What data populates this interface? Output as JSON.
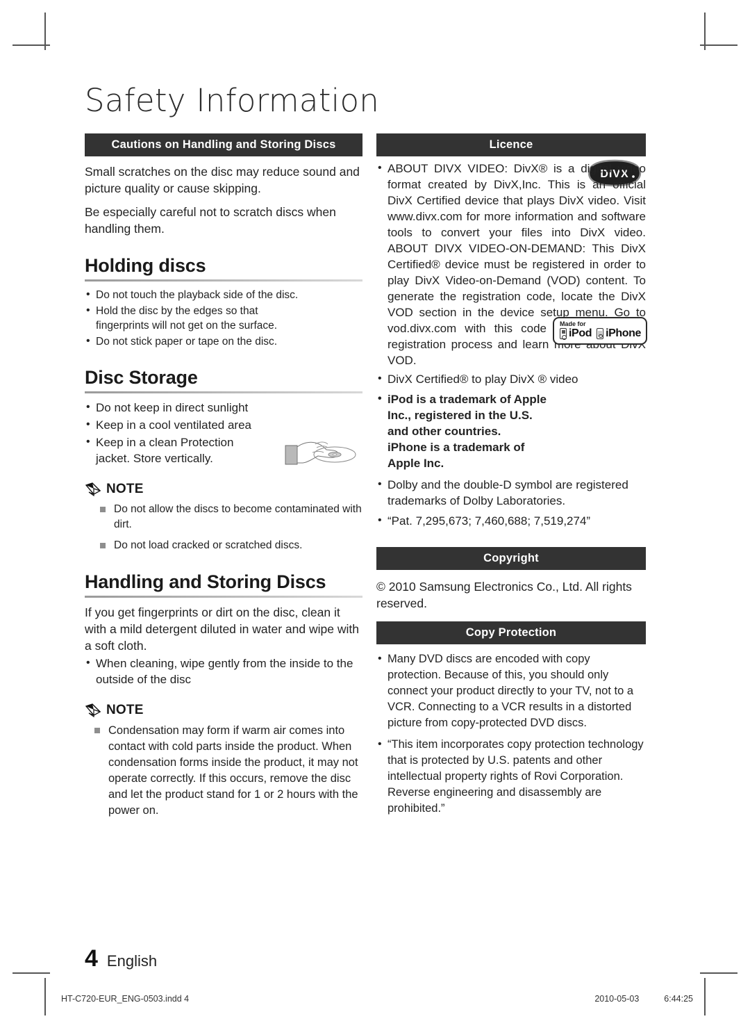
{
  "page": {
    "title": "Safety Information",
    "number": "4",
    "language": "English"
  },
  "left_column": {
    "section_bar": "Cautions on Handling and Storing Discs",
    "intro_paragraphs": [
      "Small scratches on the disc may reduce sound and picture quality or cause skipping.",
      "Be especially careful not to scratch discs when handling them."
    ],
    "holding_discs": {
      "heading": "Holding discs",
      "bullets": [
        "Do not touch the playback side of the disc.",
        "Hold the disc by the edges so that fingerprints will not get on the surface.",
        "Do not stick paper or tape on the disc."
      ]
    },
    "disc_storage": {
      "heading": "Disc Storage",
      "bullets": [
        "Do not keep in direct sunlight",
        "Keep in a cool ventilated area",
        "Keep in a clean Protection jacket. Store vertically."
      ]
    },
    "note_one": {
      "label": "NOTE",
      "items": [
        "Do not allow the discs to become contaminated with dirt.",
        "Do not load cracked or scratched discs."
      ]
    },
    "handling_storing": {
      "heading": "Handling and Storing Discs",
      "paragraph": "If you get fingerprints or dirt on the disc, clean it with a mild detergent diluted in water and wipe with a soft cloth.",
      "bullets": [
        "When cleaning, wipe gently from the inside to the outside of the disc"
      ]
    },
    "note_two": {
      "label": "NOTE",
      "items": [
        "Condensation may form if warm air comes into contact with cold parts inside the product. When condensation forms inside the product, it may not operate correctly. If this occurs, remove the disc and let the product stand for 1 or 2 hours with the power on."
      ]
    }
  },
  "right_column": {
    "licence": {
      "section_bar": "Licence",
      "divx_paragraph": "ABOUT DIVX VIDEO: DivX® is a digital video format created by DivX,Inc. This is an official DivX Certified device that plays DivX video. Visit www.divx.com for more information and software tools to convert your files into DivX video. ABOUT DIVX VIDEO-ON-DEMAND: This DivX Certified® device must be registered in order to play DivX Video-on-Demand (VOD) content. To generate the registration code, locate the DivX VOD section in the device setup menu. Go to vod.divx.com with this  code to complete the registration process and learn more about DivX VOD.",
      "divx_certified": "DivX Certified® to play DivX ® video",
      "apple_trademark_bold": "iPod is a trademark of Apple Inc., registered in the U.S. and other countries.",
      "apple_trademark_bold_2": "iPhone is a trademark of Apple Inc.",
      "dolby": "Dolby and the double-D symbol are registered trademarks of Dolby Laboratories.",
      "patents": "“Pat. 7,295,673; 7,460,688; 7,519,274”",
      "divx_logo_text": "DIVX",
      "ipod_badge": {
        "made_for": "Made for",
        "ipod": "iPod",
        "iphone": "iPhone"
      }
    },
    "copyright": {
      "section_bar": "Copyright",
      "text": "© 2010 Samsung Electronics Co., Ltd. All rights reserved."
    },
    "copy_protection": {
      "section_bar": "Copy Protection",
      "bullets": [
        "Many DVD discs are encoded with copy protection. Because of this, you should only connect your product directly to your TV, not to a VCR. Connecting to a VCR results in a distorted picture from copy-protected DVD discs.",
        "“This item incorporates copy protection technology that is protected by U.S. patents and other intellectual property rights of Rovi Corporation. Reverse engineering and disassembly are prohibited.”"
      ]
    }
  },
  "print_footer": {
    "filename": "HT-C720-EUR_ENG-0503.indd   4",
    "date": "2010-05-03",
    "time": "6:44:25"
  },
  "colors": {
    "bar_background": "#333333",
    "bar_text": "#ffffff",
    "body_text": "#232323"
  }
}
